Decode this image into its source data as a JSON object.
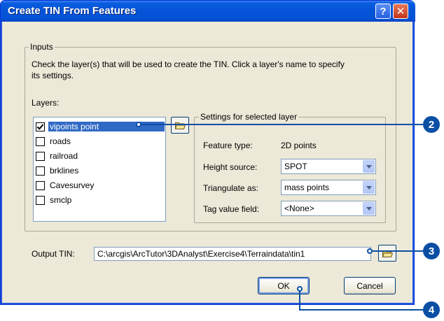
{
  "window": {
    "title": "Create TIN From Features",
    "help_icon": "?",
    "close_icon": "✕"
  },
  "inputs_group": {
    "legend": "Inputs",
    "description_line1": "Check the layer(s) that will be used to create the TIN.  Click a layer's name to specify",
    "description_line2": "its settings.",
    "layers_label": "Layers:",
    "layers": [
      {
        "label": "vipoints point",
        "checked": true,
        "selected": true
      },
      {
        "label": "roads",
        "checked": false,
        "selected": false
      },
      {
        "label": "railroad",
        "checked": false,
        "selected": false
      },
      {
        "label": "brklines",
        "checked": false,
        "selected": false
      },
      {
        "label": "Cavesurvey",
        "checked": false,
        "selected": false
      },
      {
        "label": "smclp",
        "checked": false,
        "selected": false
      }
    ]
  },
  "settings_group": {
    "legend": "Settings for selected layer",
    "feature_type_label": "Feature type:",
    "feature_type_value": "2D points",
    "height_source_label": "Height source:",
    "height_source_value": "SPOT",
    "triangulate_label": "Triangulate as:",
    "triangulate_value": "mass points",
    "tag_value_label": "Tag value field:",
    "tag_value_value": "<None>"
  },
  "output": {
    "label": "Output TIN:",
    "value": "C:\\arcgis\\ArcTutor\\3DAnalyst\\Exercise4\\Terraindata\\tin1"
  },
  "buttons": {
    "ok": "OK",
    "cancel": "Cancel"
  },
  "callouts": [
    "2",
    "3",
    "4"
  ],
  "colors": {
    "title_bar": "#0553d8",
    "selection": "#316ac5",
    "callout": "#0b4fa4",
    "dialog_face": "#ece9d8"
  }
}
